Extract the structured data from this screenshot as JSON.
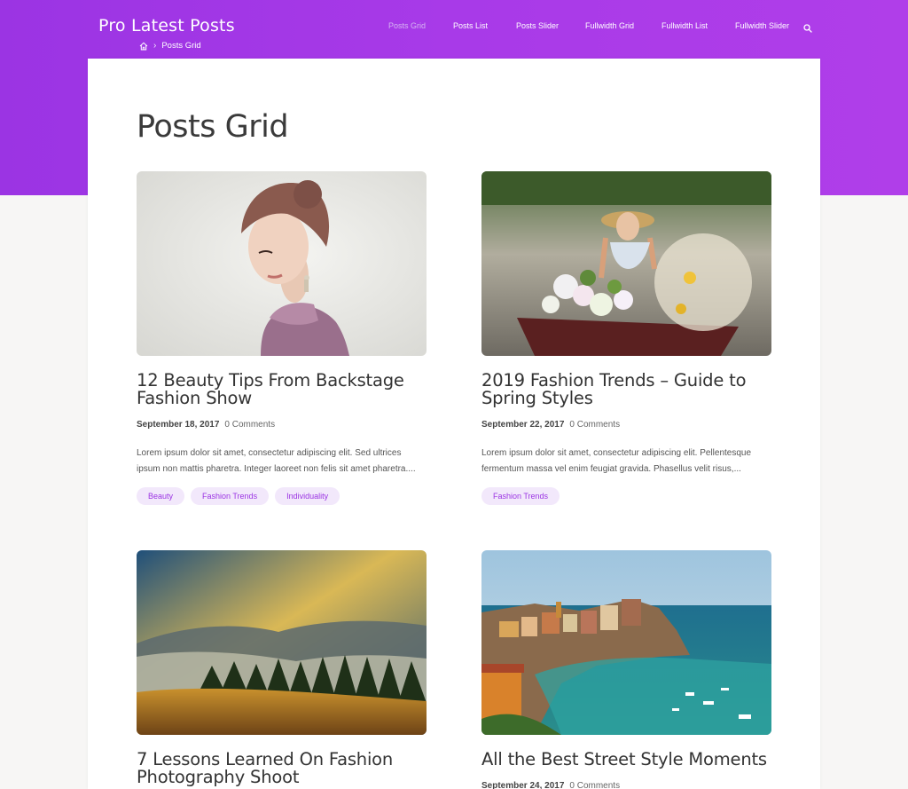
{
  "header": {
    "site_title": "Pro Latest Posts",
    "breadcrumb": {
      "current": "Posts Grid"
    },
    "nav": [
      "Posts Grid",
      "Posts List",
      "Posts Slider",
      "Fullwidth Grid",
      "Fullwidth List",
      "Fullwidth Slider"
    ],
    "active_nav": "Posts Grid"
  },
  "page": {
    "title": "Posts Grid"
  },
  "colors": {
    "brand": "#a83ae8",
    "tag_bg": "#f2e8fb",
    "tag_text": "#9b34e3"
  },
  "posts": [
    {
      "title": "12 Beauty Tips From Backstage Fashion Show",
      "date": "September 18, 2017",
      "comments": "0 Comments",
      "excerpt": "Lorem ipsum dolor sit amet, consectetur adipiscing elit. Sed ultrices ipsum non mattis pharetra. Integer laoreet non felis sit amet pharetra....",
      "tags": [
        "Beauty",
        "Fashion Trends",
        "Individuality"
      ],
      "image": "woman-portrait-photo"
    },
    {
      "title": "2019 Fashion Trends – Guide to Spring Styles",
      "date": "September 22, 2017",
      "comments": "0 Comments",
      "excerpt": "Lorem ipsum dolor sit amet, consectetur adipiscing elit. Pellentesque fermentum massa vel enim feugiat gravida. Phasellus velit risus,...",
      "tags": [
        "Fashion Trends"
      ],
      "image": "woman-in-boat-with-flowers-photo"
    },
    {
      "title": "7 Lessons Learned On Fashion Photography Shoot",
      "date": "",
      "comments": "",
      "excerpt": "",
      "tags": [],
      "image": "mountain-landscape-photo"
    },
    {
      "title": "All the Best Street Style Moments",
      "date": "September 24, 2017",
      "comments": "0 Comments",
      "excerpt": "",
      "tags": [],
      "image": "coastal-village-photo"
    }
  ]
}
